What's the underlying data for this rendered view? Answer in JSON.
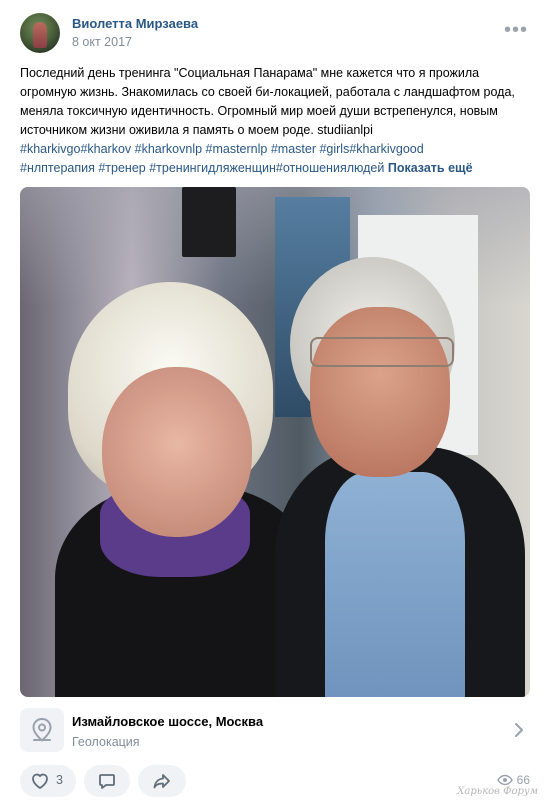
{
  "post": {
    "author": "Виолетта Мирзаева",
    "date": "8 окт 2017",
    "text": "Последний день тренинга \"Социальная Панарама\" мне кажется что я прожила огромную жизнь. Знакомилась со своей би-локацией, работала с ландшафтом рода, меняла токсичную идентичность. Огромный мир моей души встрепенулся, новым источником жизни оживила я память о моем роде. studiianlpi",
    "tags_line1": "#kharkivgo#kharkov #kharkovnlp #masternlp #master #girls#kharkivgood",
    "tags_line2": "#нлптерапия #тренер #тренингидляженщин#отношениялюдей",
    "show_more": "Показать ещё"
  },
  "location": {
    "title": "Измайловское шоссе, Москва",
    "subtitle": "Геолокация"
  },
  "actions": {
    "likes": "3",
    "views": "66"
  },
  "watermark": "Харьков Форум",
  "icons": {
    "more": "more-horizontal-icon",
    "geo": "location-pin-icon",
    "chevron": "chevron-right-icon",
    "like": "heart-icon",
    "comment": "comment-icon",
    "share": "share-icon",
    "views": "eye-icon"
  },
  "colors": {
    "link": "#2a5885",
    "muted": "#818c99",
    "button_bg": "#f0f2f5"
  }
}
